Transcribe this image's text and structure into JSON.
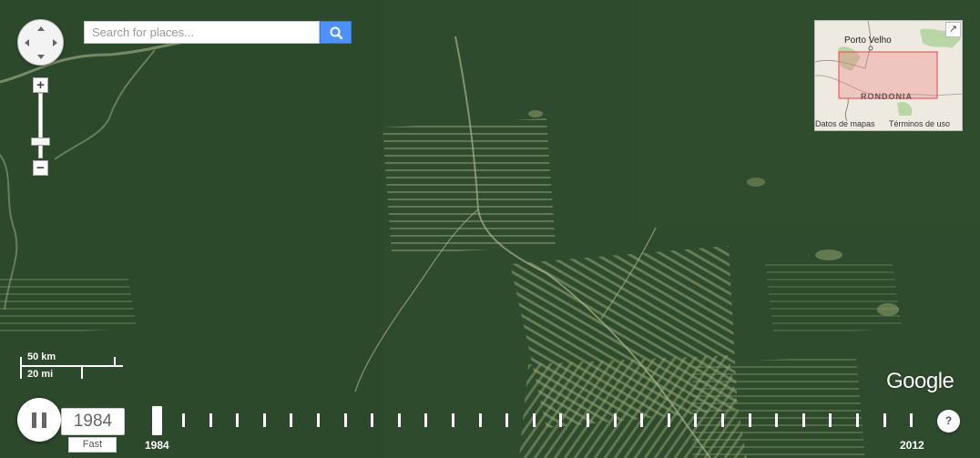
{
  "search": {
    "placeholder": "Search for places..."
  },
  "inset_map": {
    "city": "Porto Velho",
    "region": "RONDONIA",
    "attribution": "Datos de mapas",
    "terms": "Términos de uso"
  },
  "scale": {
    "km": "50 km",
    "mi": "20 mi"
  },
  "logo": "Google",
  "timelapse": {
    "current_year": "1984",
    "speed": "Fast",
    "start_label": "1984",
    "end_label": "2012",
    "help": "?",
    "playing": true
  },
  "icons": {
    "search": "search-icon",
    "pause": "pause-icon",
    "expand": "expand-icon",
    "pan": "pan-control-icon"
  },
  "colors": {
    "forest": "#2d4a2c",
    "clearing": "#8a9868",
    "search_button": "#4d90fe",
    "inset_box": "#f08080"
  }
}
